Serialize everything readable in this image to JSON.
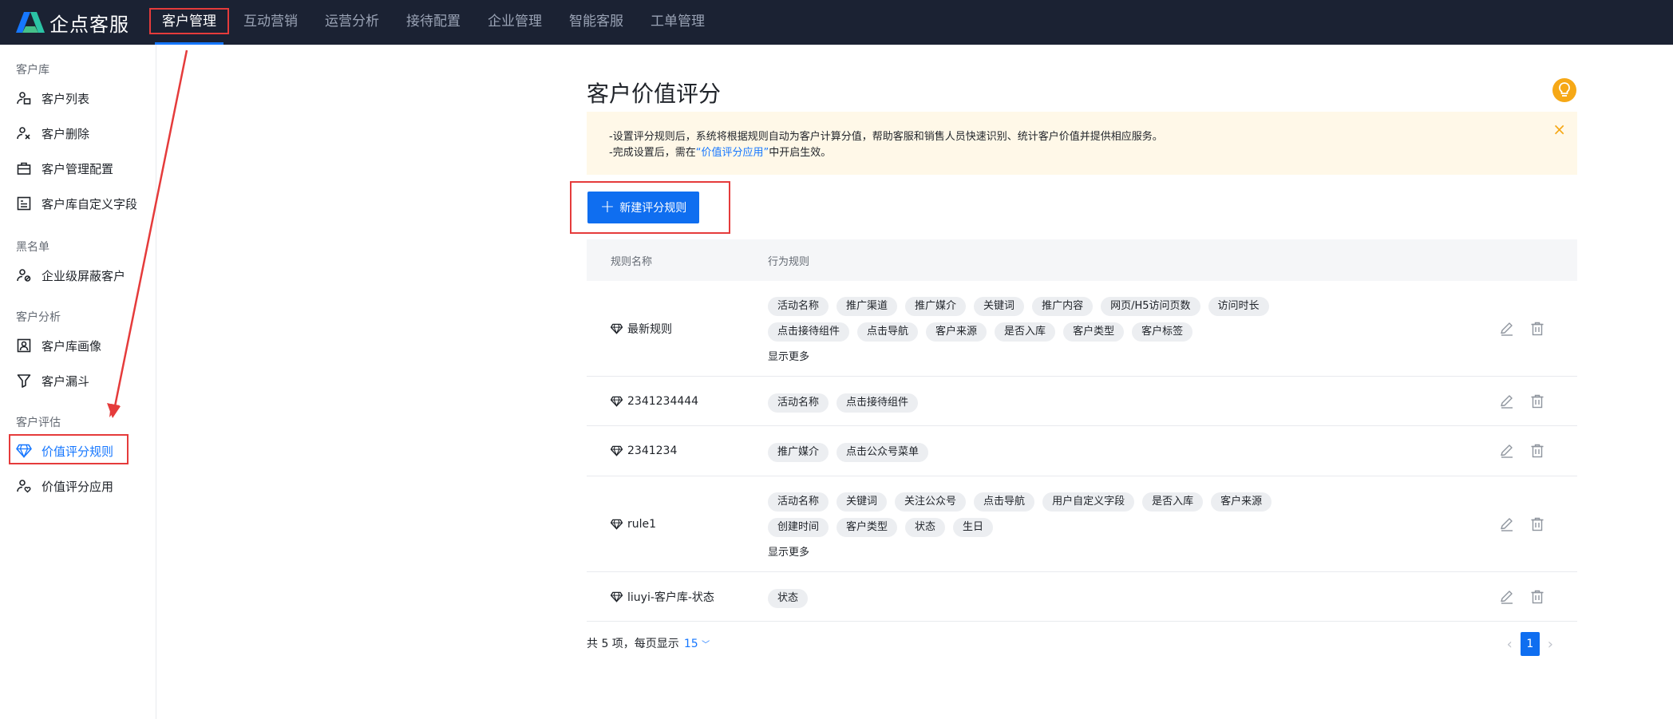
{
  "app": {
    "logo_text": "企点客服"
  },
  "nav": [
    {
      "label": "客户管理",
      "active": true
    },
    {
      "label": "互动营销"
    },
    {
      "label": "运营分析"
    },
    {
      "label": "接待配置"
    },
    {
      "label": "企业管理"
    },
    {
      "label": "智能客服"
    },
    {
      "label": "工单管理"
    }
  ],
  "sidebar": {
    "groups": [
      {
        "label": "客户库",
        "items": [
          {
            "label": "客户列表",
            "icon": "customer-list-icon"
          },
          {
            "label": "客户删除",
            "icon": "user-delete-icon"
          },
          {
            "label": "客户管理配置",
            "icon": "briefcase-icon"
          },
          {
            "label": "客户库自定义字段",
            "icon": "custom-field-icon"
          }
        ]
      },
      {
        "label": "黑名单",
        "items": [
          {
            "label": "企业级屏蔽客户",
            "icon": "user-block-icon"
          }
        ]
      },
      {
        "label": "客户分析",
        "items": [
          {
            "label": "客户库画像",
            "icon": "portrait-icon"
          },
          {
            "label": "客户漏斗",
            "icon": "funnel-icon"
          }
        ]
      },
      {
        "label": "客户评估",
        "items": [
          {
            "label": "价值评分规则",
            "icon": "diamond-icon",
            "active": true
          },
          {
            "label": "价值评分应用",
            "icon": "user-heart-icon"
          }
        ]
      }
    ]
  },
  "main": {
    "title": "客户价值评分",
    "notice": {
      "line1": "-设置评分规则后，系统将根据规则自动为客户计算分值，帮助客服和销售人员快速识别、统计客户价值并提供相应服务。",
      "line2_prefix": "-完成设置后，需在",
      "line2_link": "“价值评分应用”",
      "line2_suffix": "中开启生效。",
      "close": "×"
    },
    "new_button": "新建评分规则",
    "table": {
      "headers": [
        "规则名称",
        "行为规则"
      ],
      "rows": [
        {
          "name": "最新规则",
          "tags": [
            "活动名称",
            "推广渠道",
            "推广媒介",
            "关键词",
            "推广内容",
            "网页/H5访问页数",
            "访问时长",
            "点击接待组件",
            "点击导航",
            "客户来源",
            "是否入库",
            "客户类型",
            "客户标签"
          ],
          "more": "显示更多"
        },
        {
          "name": "2341234444",
          "tags": [
            "活动名称",
            "点击接待组件"
          ]
        },
        {
          "name": "2341234",
          "tags": [
            "推广媒介",
            "点击公众号菜单"
          ]
        },
        {
          "name": "rule1",
          "tags": [
            "活动名称",
            "关键词",
            "关注公众号",
            "点击导航",
            "用户自定义字段",
            "是否入库",
            "客户来源",
            "创建时间",
            "客户类型",
            "状态",
            "生日"
          ],
          "more": "显示更多"
        },
        {
          "name": "liuyi-客户库-状态",
          "tags": [
            "状态"
          ]
        }
      ]
    },
    "footer": {
      "total_text": "共 5 项，每页显示",
      "page_size": "15",
      "current_page": "1"
    }
  }
}
